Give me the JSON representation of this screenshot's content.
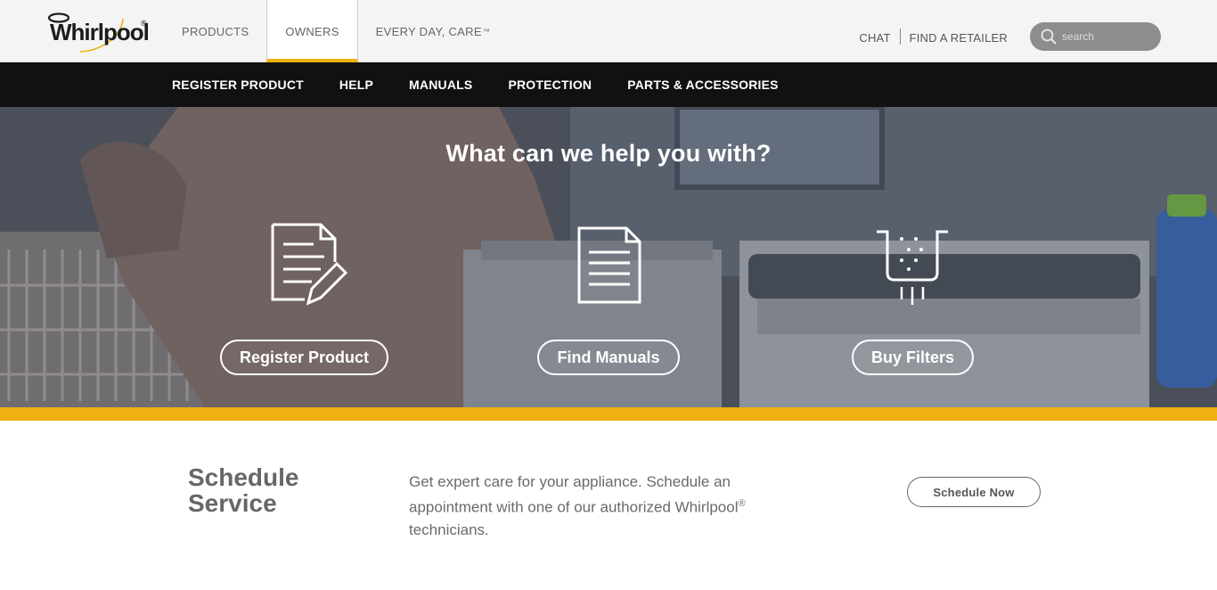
{
  "brand": {
    "logo_text": "Whirlpool",
    "logo_mark": "®"
  },
  "main_nav": {
    "products": "PRODUCTS",
    "owners": "OWNERS",
    "everyday_care": "EVERY DAY, CARE",
    "everyday_care_tm": "™"
  },
  "utility": {
    "chat": "CHAT",
    "find_retailer": "FIND A RETAILER",
    "search_placeholder": "search"
  },
  "sub_nav": [
    "REGISTER PRODUCT",
    "HELP",
    "MANUALS",
    "PROTECTION",
    "PARTS & ACCESSORIES"
  ],
  "hero": {
    "heading": "What can we help you with?",
    "cards": [
      {
        "icon": "register-document-pencil-icon",
        "label": "Register Product"
      },
      {
        "icon": "manual-document-icon",
        "label": "Find Manuals"
      },
      {
        "icon": "water-filter-icon",
        "label": "Buy Filters"
      }
    ]
  },
  "schedule": {
    "title_line1": "Schedule",
    "title_line2": "Service",
    "description": "Get expert care for your appliance. Schedule an appointment with one of our authorized Whirlpool",
    "description_reg": "®",
    "description_end": "technicians.",
    "button": "Schedule Now"
  },
  "colors": {
    "accent_yellow": "#eeb111",
    "subnav_bg": "#111111",
    "text_gray": "#676767"
  }
}
